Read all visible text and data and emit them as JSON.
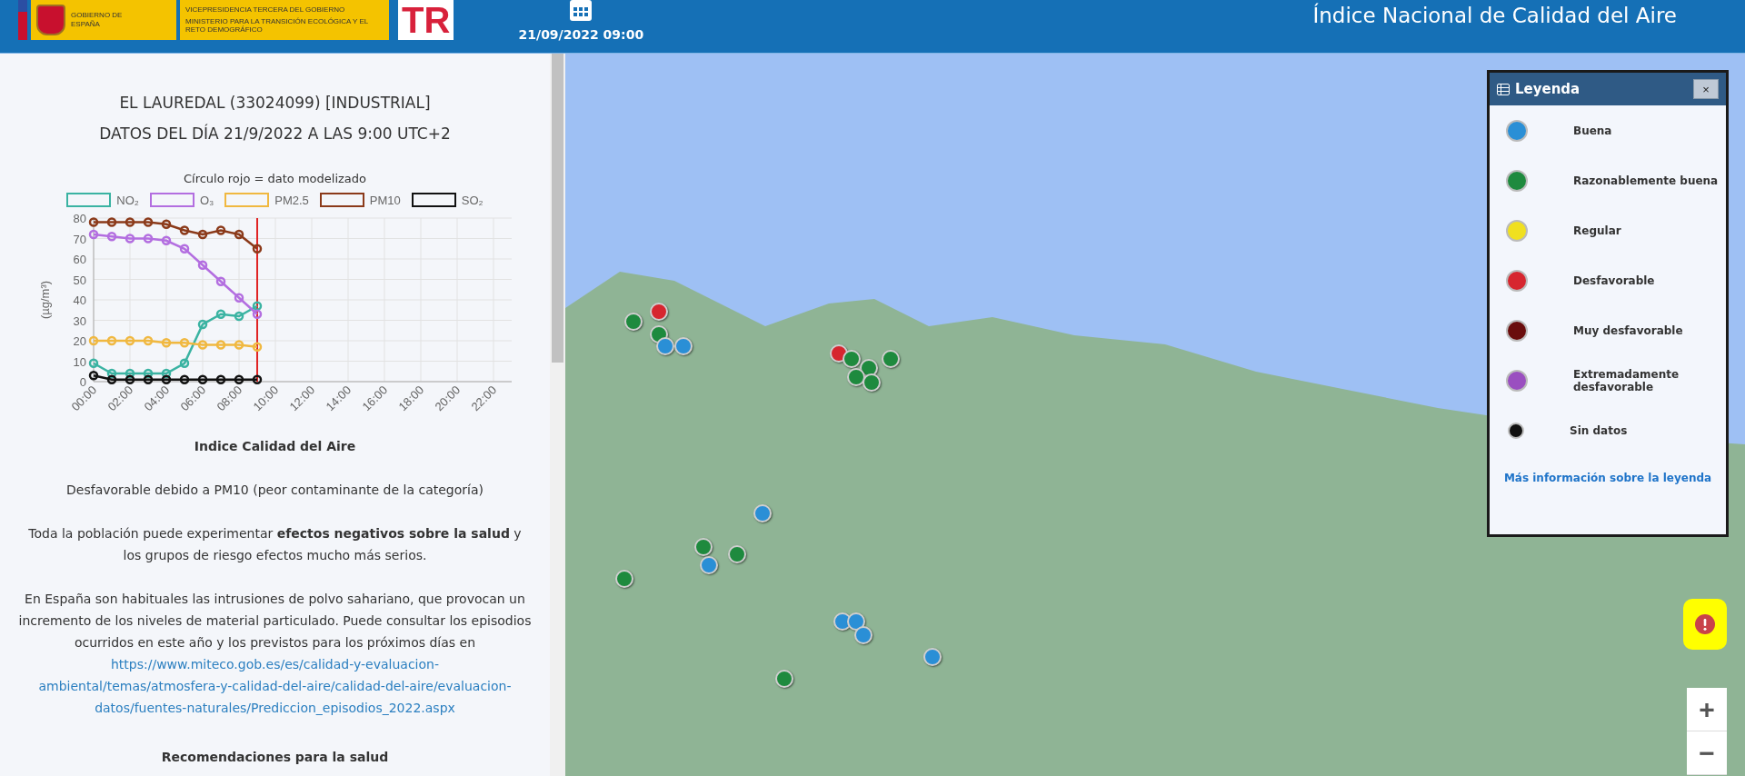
{
  "header": {
    "logo_texts": {
      "government": "GOBIERNO DE ESPAÑA",
      "vicepresidency": "VICEPRESIDENCIA TERCERA DEL GOBIERNO",
      "ministry": "MINISTERIO PARA LA TRANSICIÓN ECOLÓGICA Y EL RETO DEMOGRÁFICO",
      "prtr": "TR"
    },
    "date": "21/09/2022 09:00",
    "title": "Índice Nacional de Calidad del Aire"
  },
  "station": {
    "name": "EL LAUREDAL (33024099) [INDUSTRIAL]",
    "subtitle": "DATOS DEL DÍA 21/9/2022 A LAS 9:00 UTC+2",
    "chart_note": "Círculo rojo = dato modelizado",
    "chart_data": {
      "type": "line",
      "ylabel": "(µg/m³)",
      "x": [
        0,
        1,
        2,
        3,
        4,
        5,
        6,
        7,
        8,
        9
      ],
      "xlim": [
        0,
        23
      ],
      "ylim": [
        0,
        80
      ],
      "xticks": [
        {
          "value": 0,
          "label": "00:00"
        },
        {
          "value": 2,
          "label": "02:00"
        },
        {
          "value": 4,
          "label": "04:00"
        },
        {
          "value": 6,
          "label": "06:00"
        },
        {
          "value": 8,
          "label": "08:00"
        },
        {
          "value": 10,
          "label": "10:00"
        },
        {
          "value": 12,
          "label": "12:00"
        },
        {
          "value": 14,
          "label": "14:00"
        },
        {
          "value": 16,
          "label": "16:00"
        },
        {
          "value": 18,
          "label": "18:00"
        },
        {
          "value": 20,
          "label": "20:00"
        },
        {
          "value": 22,
          "label": "22:00"
        }
      ],
      "yticks": [
        0,
        10,
        20,
        30,
        40,
        50,
        60,
        70,
        80
      ],
      "series": [
        {
          "name": "NO₂",
          "marker": "circle",
          "color": "#3ab3a2",
          "values": [
            9,
            4,
            4,
            4,
            4,
            9,
            28,
            33,
            32,
            37
          ]
        },
        {
          "name": "O₃",
          "marker": "circle",
          "color": "#b36ee0",
          "values": [
            72,
            71,
            70,
            70,
            69,
            65,
            57,
            49,
            41,
            33
          ]
        },
        {
          "name": "PM2.5",
          "marker": "circle",
          "color": "#f0b840",
          "values": [
            20,
            20,
            20,
            20,
            19,
            19,
            18,
            18,
            18,
            17
          ]
        },
        {
          "name": "PM10",
          "marker": "circle",
          "color": "#8b3a1a",
          "values": [
            78,
            78,
            78,
            78,
            77,
            74,
            72,
            74,
            72,
            65
          ]
        },
        {
          "name": "SO₂",
          "marker": "circle",
          "color": "#111111",
          "values": [
            3,
            1,
            1,
            1,
            1,
            1,
            1,
            1,
            1,
            1
          ]
        }
      ],
      "grid": true,
      "ref_lines": [
        {
          "axis": "x",
          "value": 9,
          "color": "#e02424"
        }
      ]
    },
    "index_title": "Indice Calidad del Aire",
    "index_reason": "Desfavorable debido a PM10 (peor contaminante de la categoría)",
    "health_text": "Toda la población puede experimentar **efectos negativos sobre la salud** y los grupos de riesgo efectos mucho más serios.",
    "dust_text": "En España son habituales las intrusiones de polvo sahariano, que provocan un incremento de los niveles de material particulado. Puede consultar los episodios ocurridos en este año y los previstos para los próximos días en",
    "dust_link": "https://www.miteco.gob.es/es/calidad-y-evaluacion-ambiental/temas/atmosfera-y-calidad-del-aire/calidad-del-aire/evaluacion-datos/fuentes-naturales/Prediccion_episodios_2022.aspx",
    "recommendations_title": "Recomendaciones para la salud"
  },
  "map": {
    "markers": [
      {
        "color": "#d6262f"
      },
      {
        "color": "#1e8a3e"
      },
      {
        "color": "#1e8a3e"
      },
      {
        "color": "#2a8fd6"
      },
      {
        "color": "#2a8fd6"
      },
      {
        "color": "#d6262f"
      },
      {
        "color": "#1e8a3e"
      },
      {
        "color": "#1e8a3e"
      },
      {
        "color": "#1e8a3e"
      },
      {
        "color": "#1e8a3e"
      },
      {
        "color": "#1e8a3e"
      },
      {
        "color": "#2a8fd6"
      },
      {
        "color": "#1e8a3e"
      },
      {
        "color": "#1e8a3e"
      },
      {
        "color": "#2a8fd6"
      },
      {
        "color": "#1e8a3e"
      },
      {
        "color": "#2a8fd6"
      },
      {
        "color": "#2a8fd6"
      },
      {
        "color": "#2a8fd6"
      },
      {
        "color": "#2a8fd6"
      },
      {
        "color": "#1e8a3e"
      }
    ],
    "zoom_in": "+",
    "zoom_out": "−"
  },
  "legend": {
    "title": "Leyenda",
    "close": "×",
    "items": [
      {
        "label": "Buena",
        "color": "#2a8fd6"
      },
      {
        "label": "Razonablemente buena",
        "color": "#1e8a3e"
      },
      {
        "label": "Regular",
        "color": "#f0e020"
      },
      {
        "label": "Desfavorable",
        "color": "#d6262f"
      },
      {
        "label": "Muy desfavorable",
        "color": "#6a0d0d"
      },
      {
        "label": "Extremadamente desfavorable",
        "color": "#9a4fc0"
      },
      {
        "label": "Sin datos",
        "color": "#111111"
      }
    ],
    "more_link": "Más información sobre la leyenda"
  }
}
